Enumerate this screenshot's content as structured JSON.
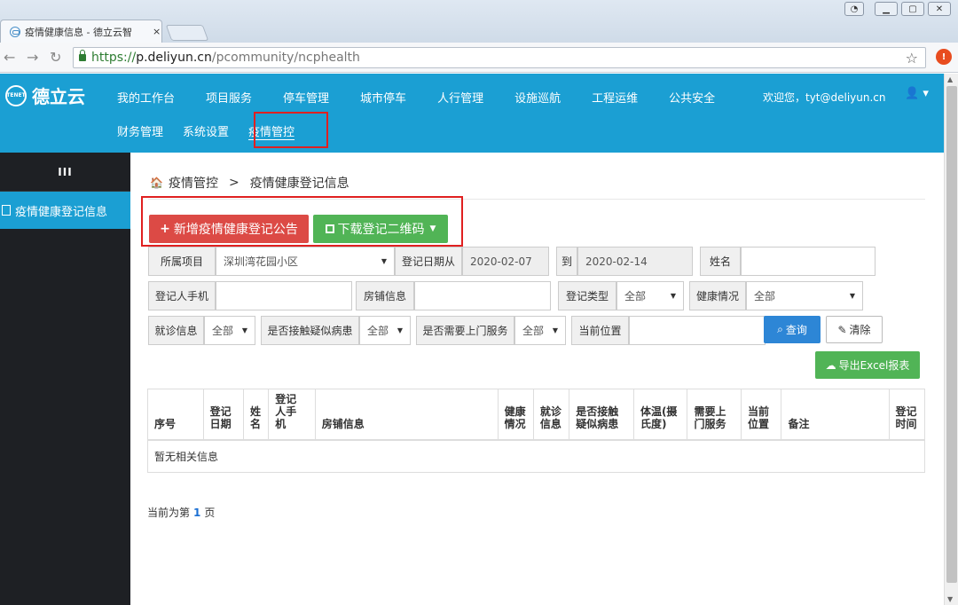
{
  "browser": {
    "tab_title": "疫情健康信息 - 德立云智",
    "tab_close": "×",
    "url_scheme": "https://",
    "url_host": "p.deliyun.cn",
    "url_path": "/pcommunity/ncphealth"
  },
  "header": {
    "logo_text": "德立云",
    "logo_mark": "TENET",
    "nav_row1": [
      "我的工作台",
      "项目服务",
      "停车管理",
      "城市停车",
      "人行管理",
      "设施巡航",
      "工程运维",
      "公共安全"
    ],
    "nav_row2": [
      "财务管理",
      "系统设置",
      "疫情管控"
    ],
    "active_nav": "疫情管控",
    "welcome": "欢迎您，tyt@deliyun.cn",
    "user_icon": "user-icon",
    "accent_color": "#1b9fd3"
  },
  "sidebar": {
    "toggle": "III",
    "items": [
      {
        "label": "疫情健康登记信息"
      }
    ]
  },
  "breadcrumb": {
    "home_icon": "home-icon",
    "root": "疫情管控",
    "separator": ">",
    "current": "疫情健康登记信息"
  },
  "actions": {
    "add_label": "新增疫情健康登记公告",
    "qr_label": "下载登记二维码",
    "search_label": "查询",
    "clear_label": "清除",
    "export_label": "导出Excel报表"
  },
  "filters": {
    "project_label": "所属项目",
    "project_value": "深圳湾花园小区",
    "date_from_label": "登记日期从",
    "date_from_value": "2020-02-07",
    "date_to_label": "到",
    "date_to_value": "2020-02-14",
    "name_label": "姓名",
    "phone_label": "登记人手机",
    "shop_label": "房铺信息",
    "type_label": "登记类型",
    "type_value": "全部",
    "health_label": "健康情况",
    "health_value": "全部",
    "visit_label": "就诊信息",
    "visit_value": "全部",
    "contact_label": "是否接触疑似病患",
    "contact_value": "全部",
    "door_label": "是否需要上门服务",
    "door_value": "全部",
    "location_label": "当前位置"
  },
  "table": {
    "columns": [
      "序号",
      "登记日期",
      "姓名",
      "登记人手机",
      "房铺信息",
      "健康情况",
      "就诊信息",
      "是否接触疑似病患",
      "体温(摄氏度)",
      "需要上门服务",
      "当前位置",
      "备注",
      "登记时间"
    ],
    "empty_text": "暂无相关信息"
  },
  "pager": {
    "prefix": "当前为第",
    "page": "1",
    "suffix": "页"
  },
  "colors": {
    "danger": "#dc4a45",
    "success": "#51b456",
    "primary": "#2d86d6",
    "highlight_border": "#e02020"
  }
}
